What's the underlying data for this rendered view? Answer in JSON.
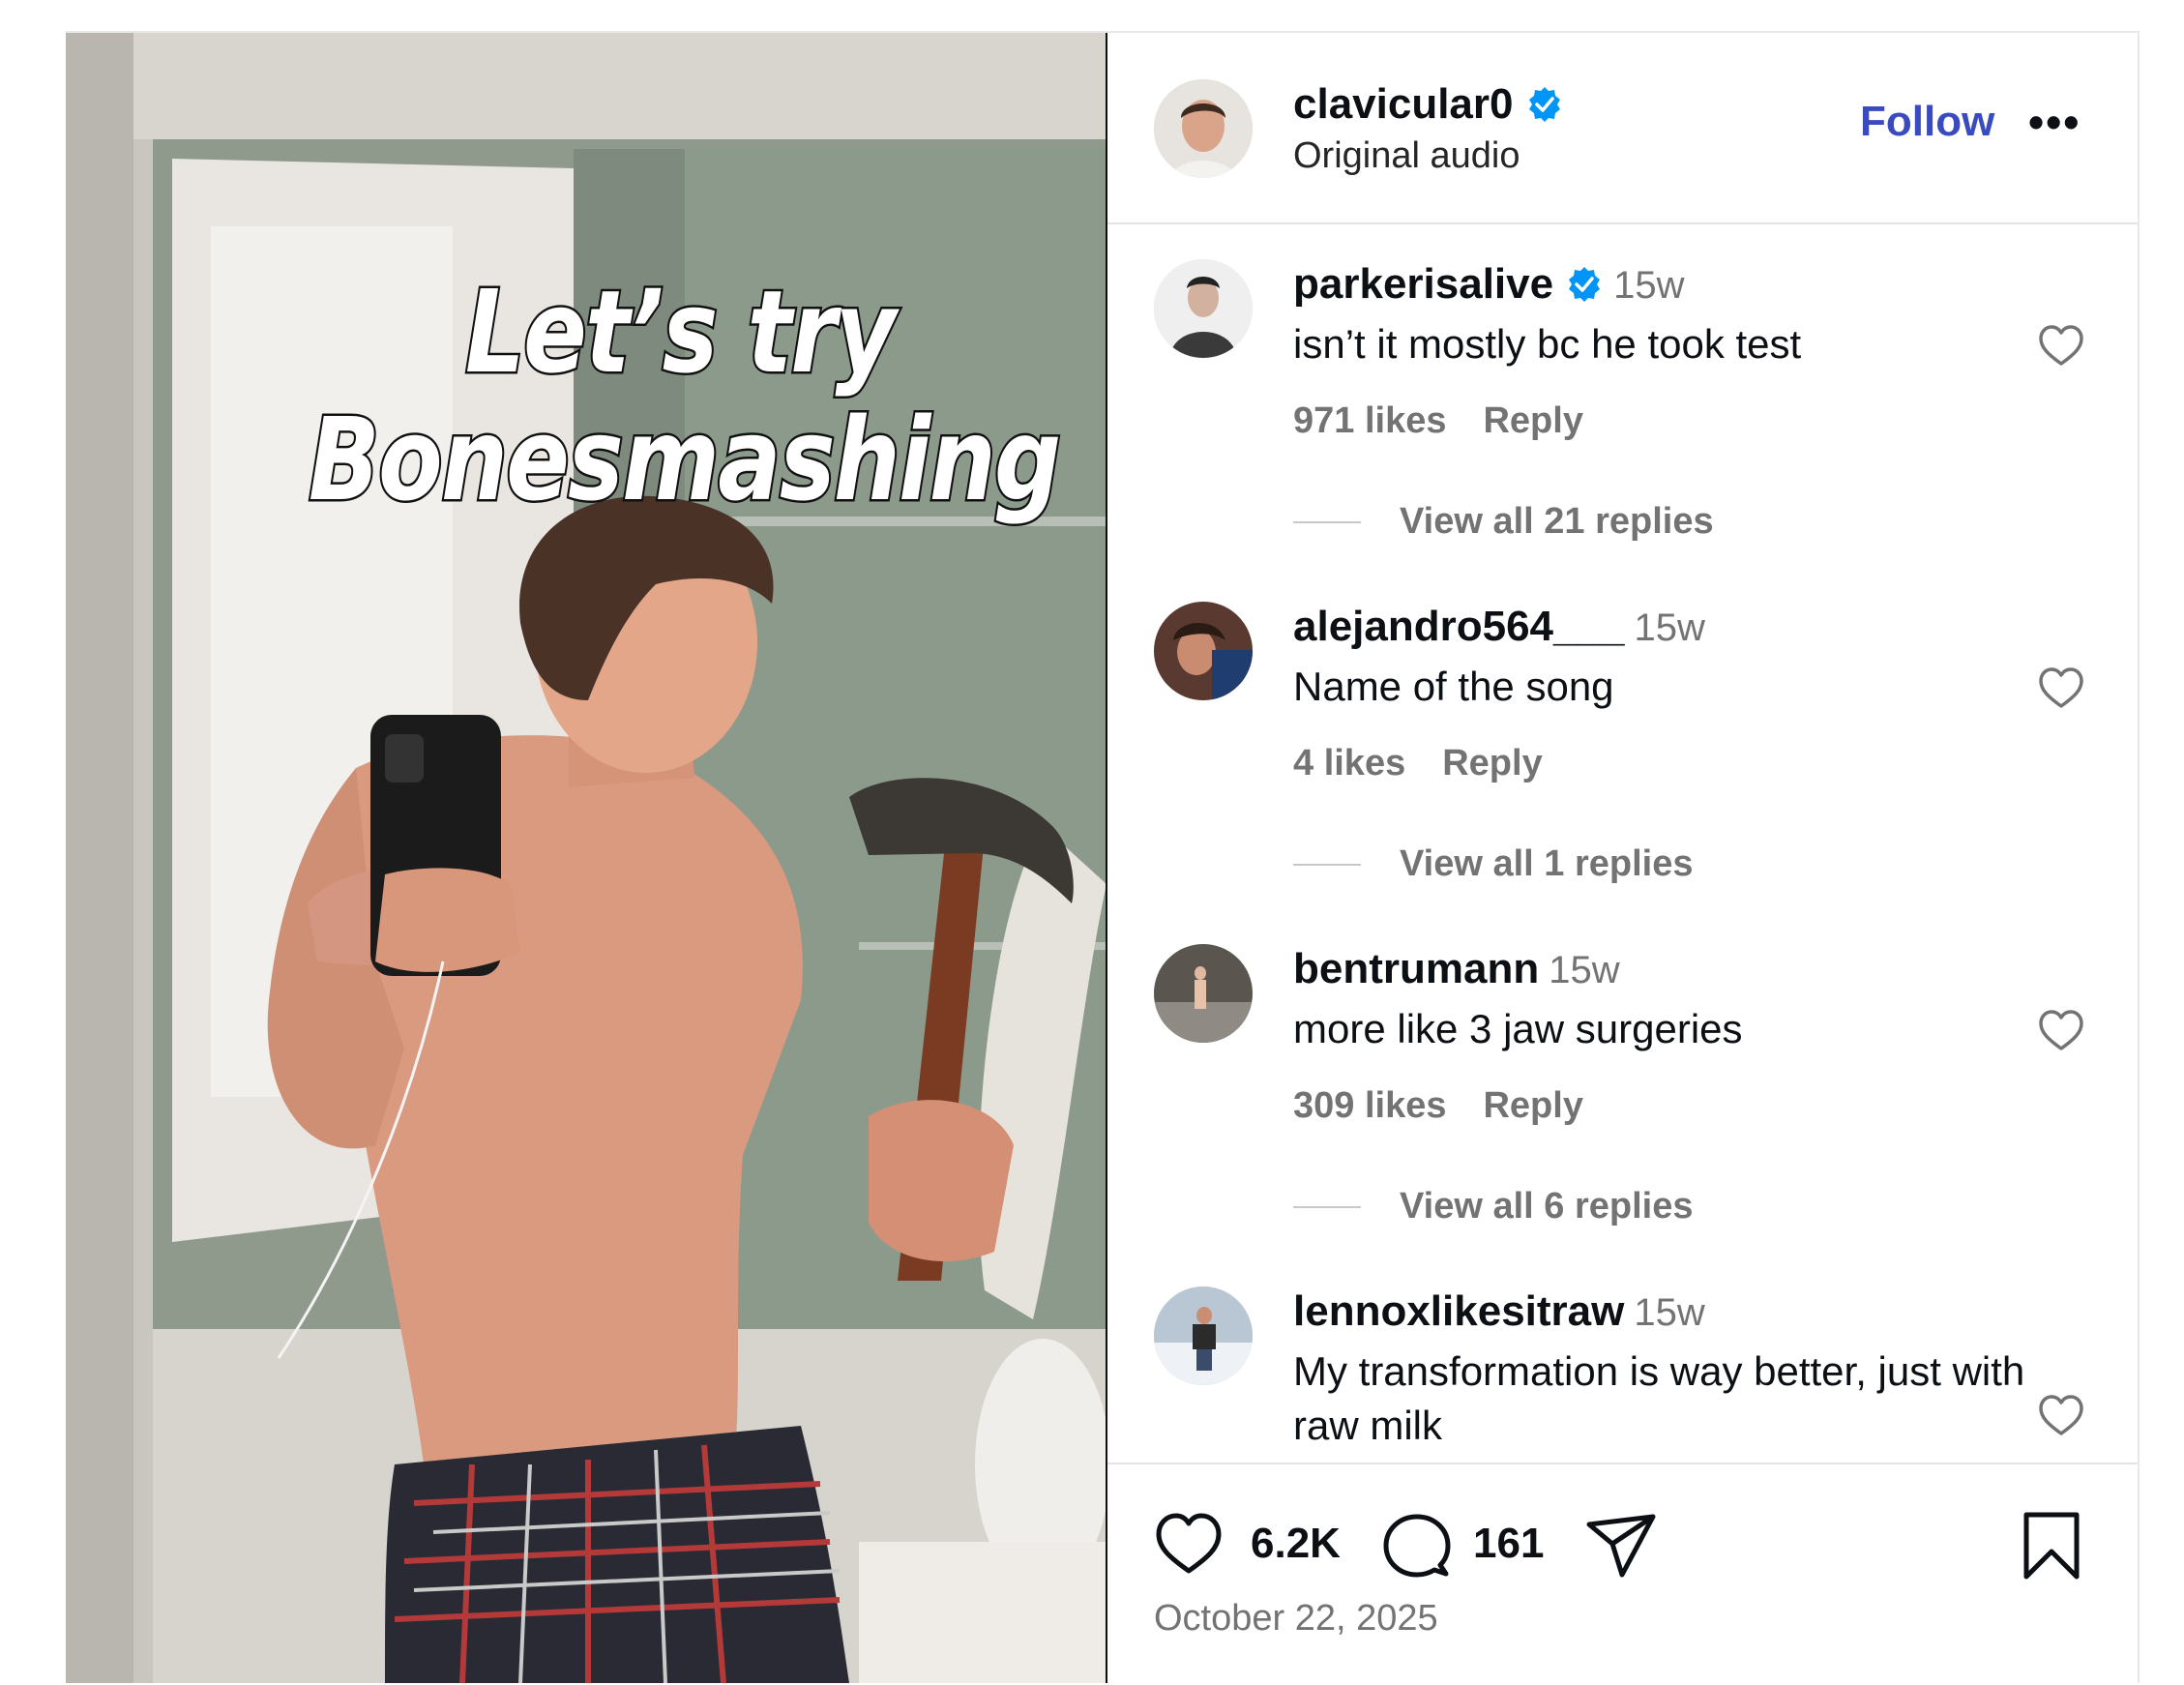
{
  "media": {
    "overlay_line1": "Let’s try",
    "overlay_line2": "Bonesmashing"
  },
  "header": {
    "username": "clavicular0",
    "verified": true,
    "audio": "Original audio",
    "follow_label": "Follow",
    "more_label": "•••"
  },
  "comments": [
    {
      "username": "parkerisalive",
      "verified": true,
      "time": "15w",
      "text": "isn’t it mostly bc he took test",
      "likes": "971 likes",
      "reply_label": "Reply",
      "view_replies": "View all 21 replies"
    },
    {
      "username": "alejandro564___",
      "verified": false,
      "time": "15w",
      "text": "Name of the song",
      "likes": "4 likes",
      "reply_label": "Reply",
      "view_replies": "View all 1 replies"
    },
    {
      "username": "bentrumann",
      "verified": false,
      "time": "15w",
      "text": "more like 3 jaw surgeries",
      "likes": "309 likes",
      "reply_label": "Reply",
      "view_replies": "View all 6 replies"
    },
    {
      "username": "lennoxlikesitraw",
      "verified": false,
      "time": "15w",
      "text": "My transformation is way better, just with raw milk"
    }
  ],
  "actions": {
    "like_count": "6.2K",
    "comment_count": "161",
    "date": "October 22, 2025"
  },
  "colors": {
    "follow_blue": "#3a4bc0",
    "verified_blue": "#0095f6",
    "secondary_text": "#737373"
  }
}
